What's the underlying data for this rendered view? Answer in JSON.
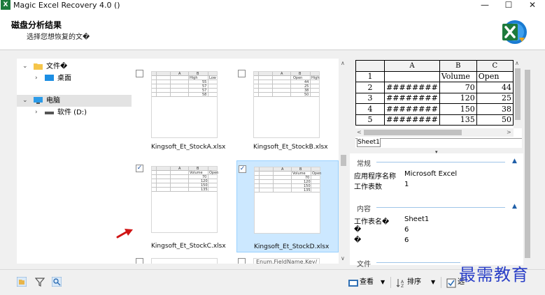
{
  "window": {
    "title": "Magic Excel Recovery 4.0 ()",
    "app_icon_letter": "X",
    "minimize": "—",
    "maximize": "☐",
    "close": "✕"
  },
  "header": {
    "title": "磁盘分析结果",
    "subtitle": "选择您想恢复的文�"
  },
  "tree": {
    "items": [
      {
        "label": "文件�",
        "icon": "folder-icon",
        "expanded": true
      },
      {
        "label": "桌面",
        "icon": "desktop-icon",
        "expanded": false
      },
      {
        "label": "电脑",
        "icon": "computer-icon",
        "expanded": true
      },
      {
        "label": "软件 (D:)",
        "icon": "drive-icon",
        "expanded": false
      }
    ]
  },
  "files": [
    {
      "name": "Kingsoft_Et_StockA.xlsx",
      "checked": false,
      "selected": false,
      "cols": [
        "A",
        "B",
        "",
        "High",
        "Low"
      ],
      "vals": [
        "55",
        "57",
        "57",
        "58",
        "58"
      ]
    },
    {
      "name": "Kingsoft_Et_StockB.xlsx",
      "checked": false,
      "selected": false,
      "cols": [
        "A",
        "B",
        "",
        "Open",
        "High"
      ],
      "vals": [
        "44",
        "25",
        "38",
        "50",
        "38"
      ]
    },
    {
      "name": "Kingsoft_Et_StockC.xlsx",
      "checked": true,
      "selected": false,
      "cols": [
        "A",
        "B",
        "",
        "Volume",
        "Open"
      ],
      "vals": [
        "70",
        "120",
        "150",
        "135",
        "148"
      ]
    },
    {
      "name": "Kingsoft_Et_StockD.xlsx",
      "checked": true,
      "selected": true,
      "cols": [
        "A",
        "B",
        "",
        "Volume",
        "Open"
      ],
      "vals": [
        "70",
        "120",
        "150",
        "135",
        "148"
      ]
    }
  ],
  "partial_file_text": "Enum.FieldName.Key/",
  "preview": {
    "columns": [
      "A",
      "B",
      "C"
    ],
    "rows": [
      {
        "n": "1",
        "a": "",
        "b": "Volume",
        "c": "Open"
      },
      {
        "n": "2",
        "a": "########",
        "b": "70",
        "c": "44"
      },
      {
        "n": "3",
        "a": "########",
        "b": "120",
        "c": "25"
      },
      {
        "n": "4",
        "a": "########",
        "b": "150",
        "c": "38"
      },
      {
        "n": "5",
        "a": "########",
        "b": "135",
        "c": "50"
      }
    ],
    "sheet_tab": "Sheet1"
  },
  "properties": {
    "general": {
      "title": "常规",
      "rows": [
        {
          "key": "应用程序名称",
          "value": "Microsoft Excel"
        },
        {
          "key": "工作表数",
          "value": "1"
        }
      ]
    },
    "content": {
      "title": "内容",
      "rows": [
        {
          "key": "工作表名�",
          "value": "Sheet1"
        },
        {
          "key": "�",
          "value": "6"
        },
        {
          "key": "�",
          "value": "6"
        }
      ]
    },
    "file_section": "文件"
  },
  "footer": {
    "view_label": "查看",
    "sort_label": "排序",
    "select_label": "选"
  },
  "watermark": "最需教育",
  "colors": {
    "accent": "#1f5fa8",
    "selected": "#cce8ff",
    "excel_green": "#1d7a3c"
  }
}
